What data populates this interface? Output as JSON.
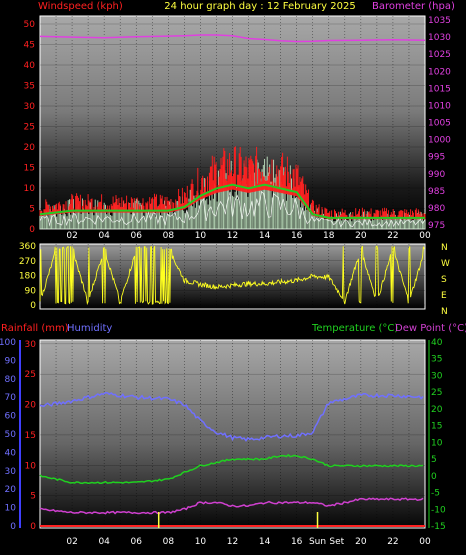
{
  "header": {
    "left": "Windspeed (kph)",
    "center": "24 hour graph day : 12 February 2025",
    "right": "Barometer (hpa)"
  },
  "colors": {
    "wind": "#ff2020",
    "gust_light": "#d8ffd8",
    "wind_avg": "#22cc22",
    "baro": "#e040e0",
    "direction": "#ffff20",
    "humidity": "#7070ff",
    "temp": "#20d020",
    "dew": "#d040d0",
    "rain": "#ff2020"
  },
  "time_labels": [
    "02",
    "04",
    "06",
    "08",
    "10",
    "12",
    "14",
    "16",
    "18",
    "20",
    "22",
    "00"
  ],
  "time_labels_bottom": [
    "02",
    "04",
    "06",
    "08",
    "10",
    "12",
    "14",
    "16",
    "Sun",
    "Set",
    "20",
    "22",
    "00"
  ],
  "wind_panel": {
    "y_left_ticks": [
      "0",
      "5",
      "10",
      "15",
      "20",
      "25",
      "30",
      "35",
      "40",
      "45",
      "50"
    ],
    "y_right_ticks": [
      "975",
      "980",
      "985",
      "990",
      "995",
      "1000",
      "1005",
      "1010",
      "1015",
      "1020",
      "1025",
      "1030",
      "1035"
    ]
  },
  "dir_panel": {
    "y_ticks": [
      "0",
      "90",
      "180",
      "270",
      "360"
    ],
    "compass": [
      "N",
      "W",
      "S",
      "E",
      "N"
    ]
  },
  "bottom_panel": {
    "label_rain": "Rainfall (mm)",
    "label_humidity": "Humidity",
    "label_temp": "Temperature (°C)",
    "label_dew": "Dew Point (°C)",
    "y_humidity_ticks": [
      "0",
      "10",
      "20",
      "30",
      "40",
      "50",
      "60",
      "70",
      "80",
      "90",
      "100"
    ],
    "y_rain_ticks": [
      "0",
      "5",
      "10",
      "15",
      "20",
      "25",
      "30"
    ],
    "y_temp_ticks": [
      "-15",
      "-10",
      "-5",
      "0",
      "5",
      "10",
      "15",
      "20",
      "25",
      "30",
      "35",
      "40"
    ]
  },
  "chart_data": [
    {
      "type": "line",
      "title": "24 hour graph day : 12 February 2025",
      "ylabel": "Windspeed (kph)",
      "y2label": "Barometer (hpa)",
      "ylim": [
        0,
        50
      ],
      "y2lim": [
        975,
        1035
      ],
      "x": [
        0,
        2,
        4,
        6,
        8,
        9,
        10,
        11,
        12,
        13,
        14,
        15,
        16,
        17,
        18,
        20,
        22,
        24
      ],
      "series": [
        {
          "name": "Windspeed (kph)",
          "values": [
            4,
            5,
            5,
            5,
            5,
            6,
            9,
            11,
            12,
            11,
            12,
            11,
            10,
            4,
            3,
            3,
            3,
            3
          ]
        },
        {
          "name": "Barometer (hpa)",
          "values": [
            1030.2,
            1030.0,
            1029.8,
            1030.1,
            1030.3,
            1030.4,
            1030.6,
            1030.6,
            1030.4,
            1029.6,
            1029.3,
            1028.9,
            1028.7,
            1028.8,
            1029.0,
            1029.1,
            1029.2,
            1029.1
          ]
        }
      ]
    },
    {
      "type": "scatter",
      "ylabel": "Wind direction",
      "ylim": [
        0,
        360
      ],
      "x": [
        0,
        1,
        2,
        3,
        4,
        5,
        6,
        7,
        8,
        9,
        10,
        11,
        12,
        13,
        14,
        15,
        16,
        17,
        18,
        19,
        20,
        21,
        22,
        23,
        24
      ],
      "series": [
        {
          "values": [
            20,
            330,
            340,
            20,
            340,
            20,
            330,
            340,
            345,
            150,
            125,
            110,
            120,
            130,
            130,
            140,
            150,
            175,
            170,
            25,
            340,
            20,
            345,
            20,
            340
          ]
        }
      ]
    },
    {
      "type": "line",
      "xlabel": "",
      "ylim": [
        0,
        100
      ],
      "x": [
        0,
        2,
        4,
        6,
        8,
        9,
        10,
        11,
        12,
        13,
        14,
        15,
        16,
        17,
        18,
        20,
        22,
        24
      ],
      "series": [
        {
          "name": "Humidity",
          "values": [
            65,
            68,
            72,
            70,
            69,
            66,
            57,
            51,
            48,
            47,
            48,
            49,
            49,
            51,
            67,
            71,
            71,
            70
          ]
        },
        {
          "name": "Temperature (°C)",
          "values": [
            0,
            -2,
            -2,
            -2,
            -1,
            1,
            3,
            4,
            5,
            5,
            5,
            6,
            6,
            5,
            3,
            3,
            3,
            3
          ]
        },
        {
          "name": "Dew Point (°C)",
          "values": [
            -10,
            -11,
            -11,
            -11,
            -11,
            -10,
            -8,
            -8,
            -9,
            -9,
            -8,
            -8,
            -8,
            -8,
            -9,
            -7,
            -7,
            -7
          ]
        },
        {
          "name": "Rainfall (mm)",
          "values": [
            0,
            0,
            0,
            0,
            0,
            0,
            0,
            0,
            0,
            0,
            0,
            0,
            0,
            0,
            0,
            0,
            0,
            0
          ]
        }
      ]
    }
  ]
}
